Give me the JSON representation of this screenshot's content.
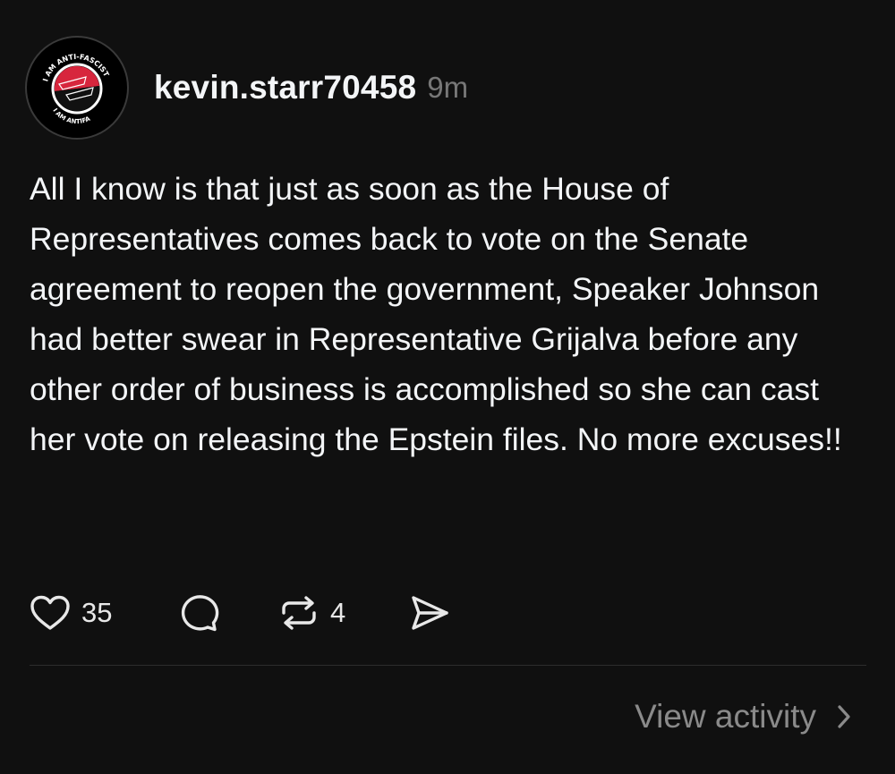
{
  "post": {
    "avatar_label": "avatar",
    "avatar_text_top": "I AM ANTI-FASCIST",
    "avatar_text_bottom": "I AM ANTIFA",
    "username": "kevin.starr70458",
    "timestamp": "9m",
    "body": "All I know is that just as soon as the House of Representatives comes back to vote on the Senate agreement to reopen the government, Speaker Johnson had better swear in Representative Grijalva before any other order of business is accomplished so she can cast her vote on releasing the Epstein files. No more excuses!!"
  },
  "actions": {
    "like_icon": "heart-icon",
    "like_count": "35",
    "reply_icon": "comment-icon",
    "repost_icon": "repost-icon",
    "repost_count": "4",
    "share_icon": "send-icon"
  },
  "footer": {
    "view_activity_label": "View activity",
    "chevron_icon": "chevron-right-icon"
  },
  "colors": {
    "background": "#101010",
    "text": "#f3f5f7",
    "muted": "#777777",
    "antifa_red": "#d7263d"
  }
}
